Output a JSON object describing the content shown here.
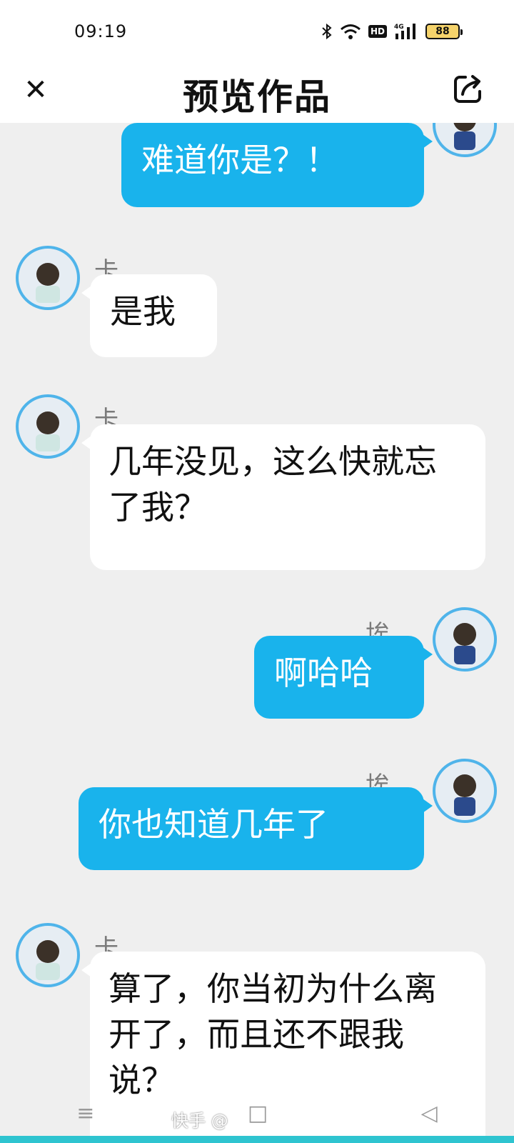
{
  "status_bar": {
    "time": "09:19",
    "network_badge": "HD",
    "network_type": "4G",
    "battery": "88"
  },
  "header": {
    "title": "预览作品",
    "close_icon": "close-icon",
    "share_icon": "share-icon"
  },
  "messages": [
    {
      "side": "right",
      "sender": "埃米",
      "text": "难道你是？！"
    },
    {
      "side": "left",
      "sender": "卡米尔",
      "text": "是我"
    },
    {
      "side": "left",
      "sender": "卡米尔",
      "text": "几年没见，这么快就忘了我？"
    },
    {
      "side": "right",
      "sender": "埃米",
      "text": "啊哈哈"
    },
    {
      "side": "right",
      "sender": "埃米",
      "text": "你也知道几年了"
    },
    {
      "side": "left",
      "sender": "卡米尔",
      "text": "算了，你当初为什么离开了，而且还不跟我说？"
    }
  ],
  "colors": {
    "right_bubble": "#19b3ec",
    "left_bubble": "#ffffff",
    "avatar_ring": "#4fb4ea",
    "background": "#efefef"
  },
  "watermark": "快手 @"
}
